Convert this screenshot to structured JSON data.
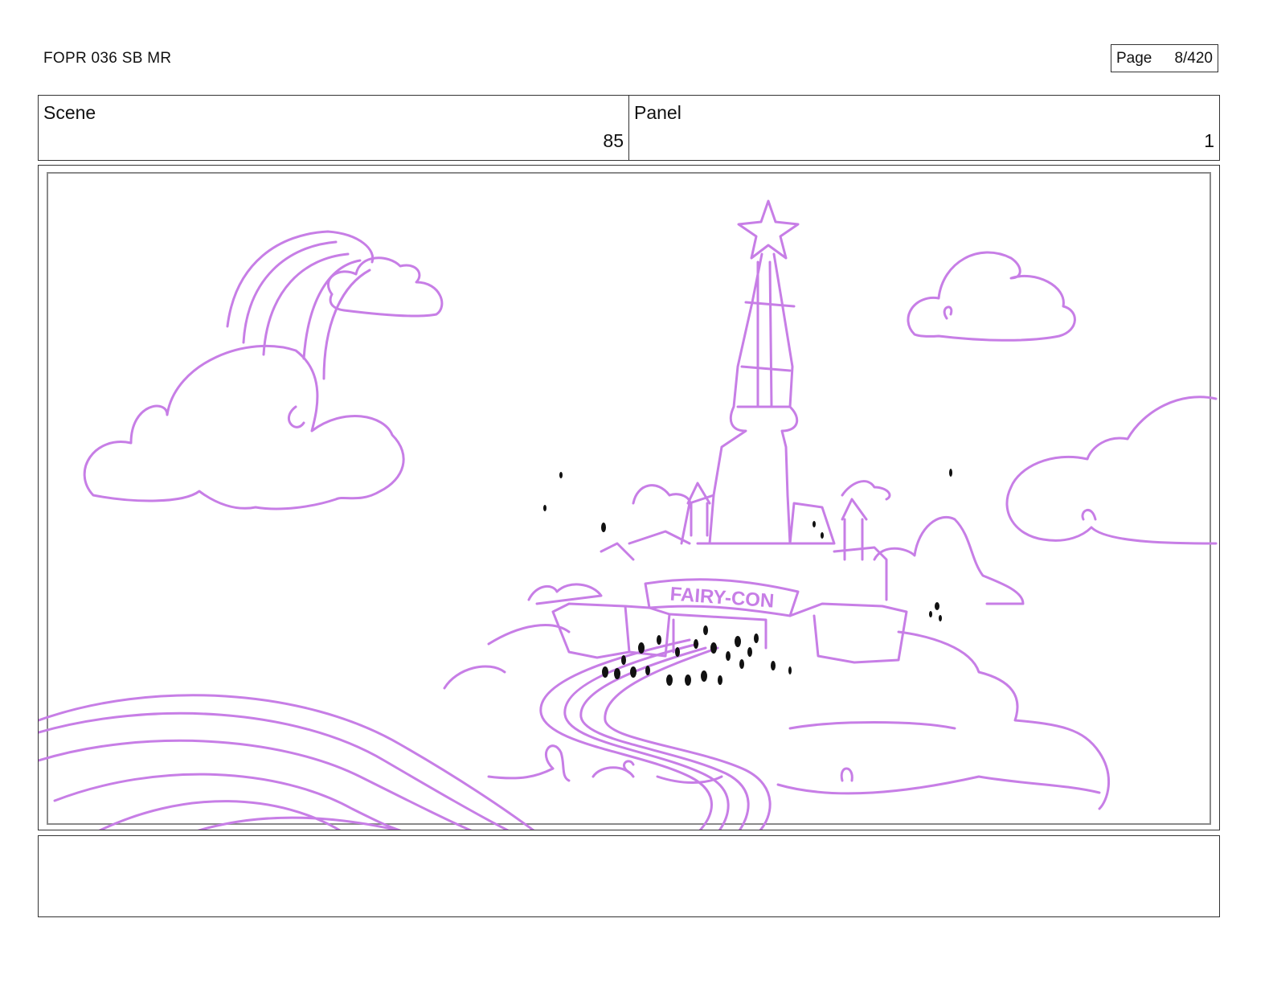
{
  "header": {
    "doc_title": "FOPR 036 SB MR",
    "page_label": "Page",
    "page_number": "8/420"
  },
  "info": {
    "scene_label": "Scene",
    "scene_value": "85",
    "panel_label": "Panel",
    "panel_value": "1"
  },
  "drawing": {
    "banner_text": "FAIRY-CON",
    "line_color": "#c77ee6",
    "ink_color": "#111111"
  }
}
